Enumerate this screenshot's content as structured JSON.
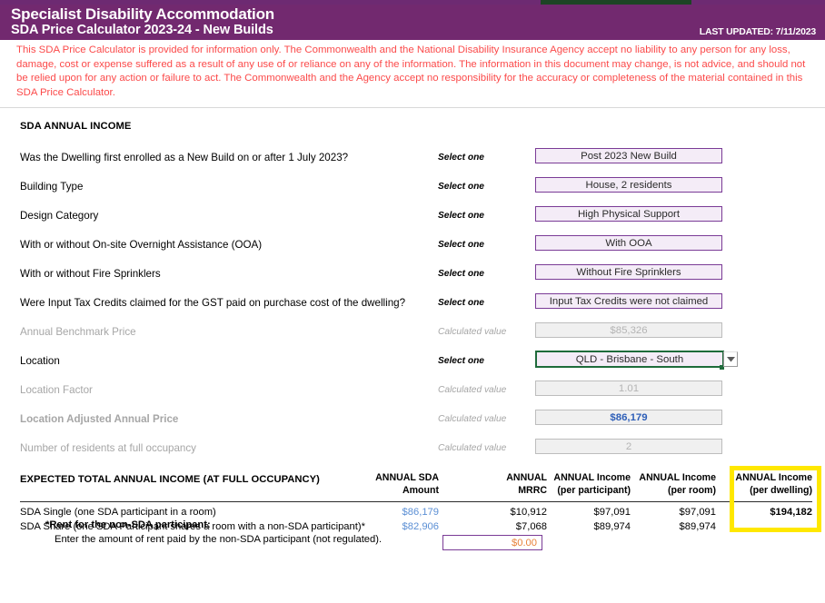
{
  "header": {
    "title_main": "Specialist Disability Accommodation",
    "title_sub": "SDA Price Calculator 2023-24 - New Builds",
    "last_updated": "LAST UPDATED: 7/11/2023",
    "band_color": "#72296f",
    "accent_strip_color": "#1d4425"
  },
  "disclaimer": {
    "text": "This SDA Price Calculator is provided for information only.  The Commonwealth and the National Disability Insurance Agency accept no liability to any person for any loss, damage, cost or expense suffered as a result of any use of or reliance on any of the information.  The information in this document may change, is not advice, and should not be relied upon for any action or failure to act. The Commonwealth and the Agency accept no responsibility for the accuracy or completeness of the material contained in this SDA Price Calculator.",
    "color": "#fb4a4a"
  },
  "section": {
    "heading": "SDA ANNUAL INCOME"
  },
  "hints": {
    "select_one": "Select one",
    "calculated_value": "Calculated value"
  },
  "form_rows": [
    {
      "label": "Was the Dwelling first enrolled as a New Build on or after 1 July 2023?",
      "hint": "Select one",
      "value": "Post 2023 New Build",
      "kind": "select",
      "name": "new-build-enrolment"
    },
    {
      "label": "Building Type",
      "hint": "Select one",
      "value": "House, 2 residents",
      "kind": "select",
      "name": "building-type"
    },
    {
      "label": "Design Category",
      "hint": "Select one",
      "value": "High Physical Support",
      "kind": "select",
      "name": "design-category"
    },
    {
      "label": "With or without On-site Overnight Assistance (OOA)",
      "hint": "Select one",
      "value": "With OOA",
      "kind": "select",
      "name": "ooa"
    },
    {
      "label": "With or without Fire Sprinklers",
      "hint": "Select one",
      "value": "Without Fire Sprinklers",
      "kind": "select",
      "name": "fire-sprinklers"
    },
    {
      "label": "Were Input Tax Credits claimed for the GST paid on purchase cost of the dwelling?",
      "hint": "Select one",
      "value": "Input Tax Credits were not claimed",
      "kind": "select",
      "name": "input-tax-credits"
    },
    {
      "label": "Annual Benchmark Price",
      "hint": "Calculated value",
      "value": "$85,326",
      "kind": "calc",
      "name": "annual-benchmark-price"
    },
    {
      "label": "Location",
      "hint": "Select one",
      "value": "QLD - Brisbane - South",
      "kind": "dropdown",
      "name": "location"
    },
    {
      "label": "Location Factor",
      "hint": "Calculated value",
      "value": "1.01",
      "kind": "calc",
      "name": "location-factor"
    },
    {
      "label": "Location Adjusted Annual Price",
      "hint": "Calculated value",
      "value": "$86,179",
      "kind": "calc-accent",
      "name": "location-adjusted-annual-price"
    },
    {
      "label": "Number of residents at full occupancy",
      "hint": "Calculated value",
      "value": "2",
      "kind": "calc",
      "name": "number-of-residents"
    }
  ],
  "table": {
    "title": "EXPECTED TOTAL ANNUAL INCOME (AT FULL OCCUPANCY)",
    "columns": [
      {
        "line1": "ANNUAL SDA",
        "line2": "Amount"
      },
      {
        "line1": "ANNUAL",
        "line2": "MRRC"
      },
      {
        "line1": "ANNUAL Income",
        "line2": "(per participant)"
      },
      {
        "line1": "ANNUAL Income",
        "line2": "(per room)"
      },
      {
        "line1": "ANNUAL Income",
        "line2": "(per dwelling)"
      }
    ],
    "rows": [
      {
        "label": "SDA Single (one SDA participant in a room)",
        "sda_amount": "$86,179",
        "mrrc": "$10,912",
        "per_participant": "$97,091",
        "per_room": "$97,091",
        "per_dwelling": "$194,182"
      },
      {
        "label": "SDA Share (one SDA Participant shares a room with a non-SDA participant)*",
        "sda_amount": "$82,906",
        "mrrc": "$7,068",
        "per_participant": "$89,974",
        "per_room": "$89,974",
        "per_dwelling": ""
      }
    ],
    "footnote_bold": "*Rent for the non-SDA participant:",
    "footnote_plain": "Enter the amount of rent paid by the non-SDA participant (not regulated).",
    "rent_input_value": "$0.00",
    "highlight_color": "#ffe800"
  }
}
